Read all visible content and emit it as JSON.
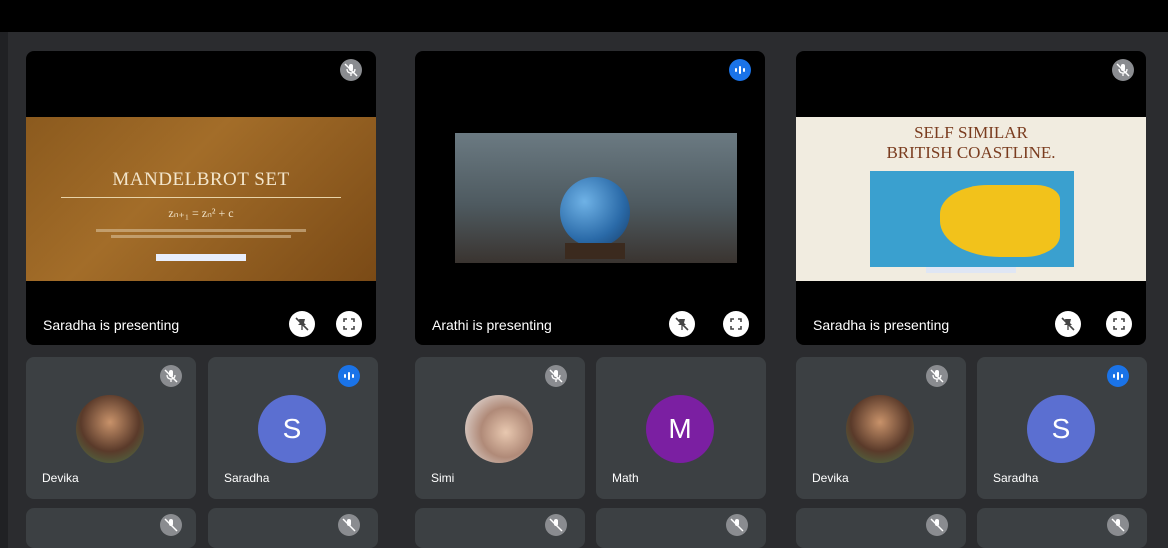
{
  "tiles_top": [
    {
      "caption": "Saradha is presenting",
      "slide": {
        "title": "MANDELBROT SET",
        "formula": "zₙ₊₁ = zₙ² + c"
      }
    },
    {
      "caption": "Arathi is presenting"
    },
    {
      "caption": "Saradha is presenting",
      "slide": {
        "title_line1": "SELF SIMILAR",
        "title_line2": "BRITISH COASTLINE."
      }
    }
  ],
  "participants": [
    {
      "name": "Devika",
      "initial": "",
      "avatar_color": "#5a8fa8",
      "status": "muted"
    },
    {
      "name": "Saradha",
      "initial": "S",
      "avatar_color": "#5b6fd1",
      "status": "speaking"
    },
    {
      "name": "Simi",
      "initial": "",
      "avatar_color": "#c9b9a8",
      "status": "muted"
    },
    {
      "name": "Math",
      "initial": "M",
      "avatar_color": "#7b1fa2",
      "status": "muted"
    },
    {
      "name": "Devika",
      "initial": "",
      "avatar_color": "#5a8fa8",
      "status": "muted"
    },
    {
      "name": "Saradha",
      "initial": "S",
      "avatar_color": "#5b6fd1",
      "status": "speaking"
    }
  ],
  "icons": {
    "mic_off": "mic-off-icon",
    "speaking": "speaking-indicator-icon",
    "pin_off": "pin-off-icon",
    "fullscreen": "fullscreen-icon"
  },
  "colors": {
    "background": "#202124",
    "tile": "#3c4043",
    "accent": "#1a73e8"
  }
}
